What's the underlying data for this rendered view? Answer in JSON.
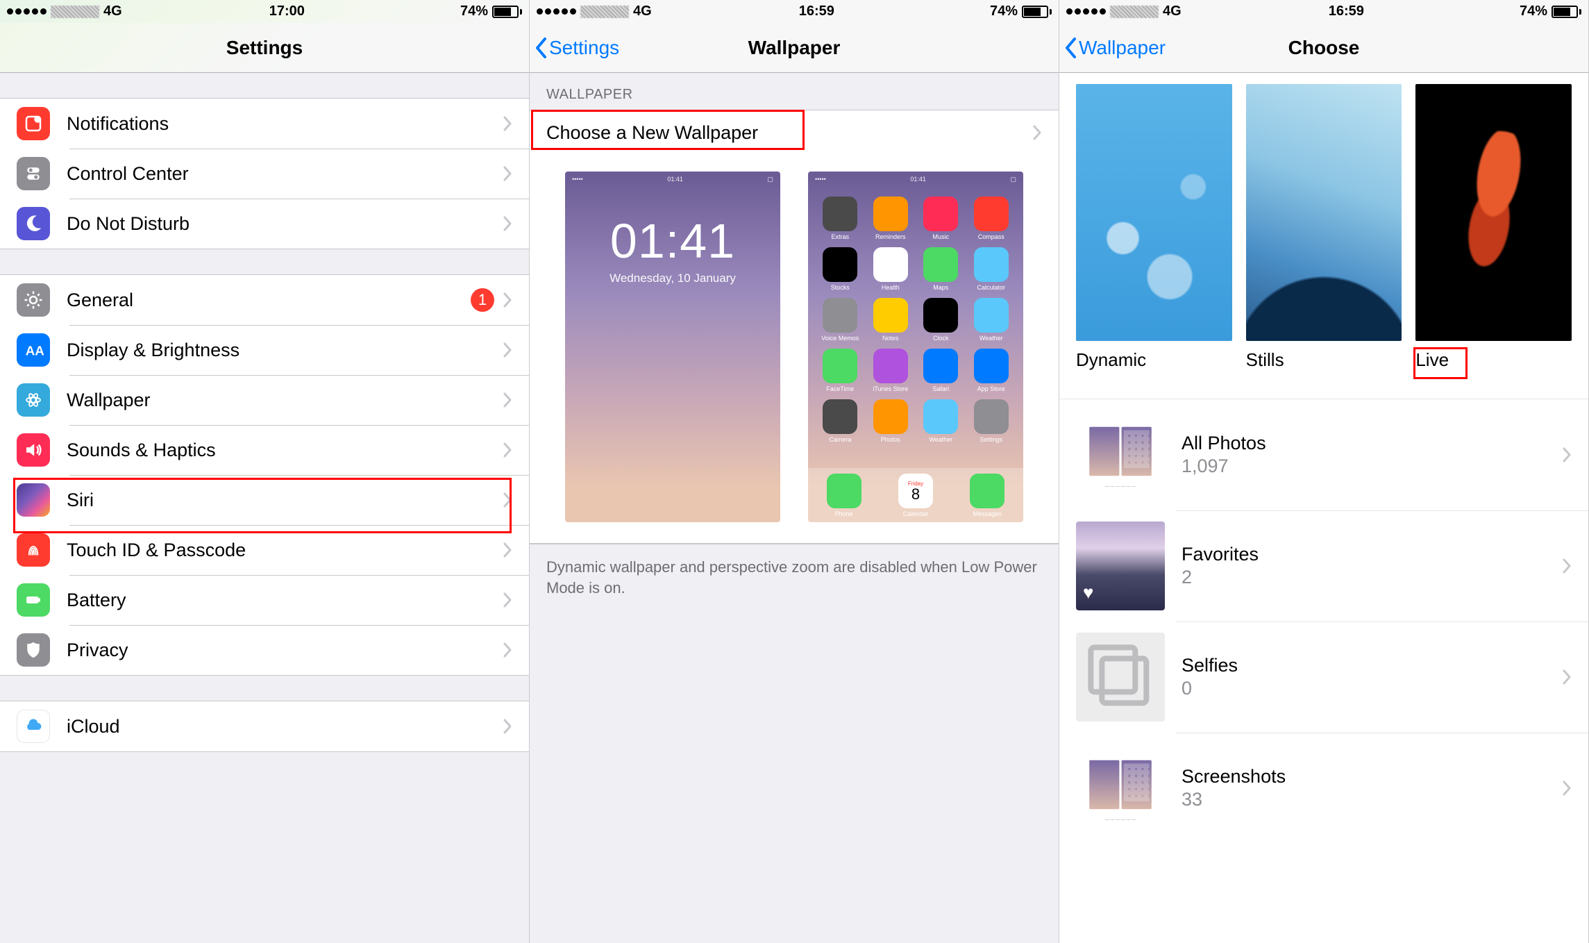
{
  "status": {
    "carrier_tech": "4G",
    "time_p1": "17:00",
    "time_p2": "16:59",
    "time_p3": "16:59",
    "battery_pct": "74%"
  },
  "panel1": {
    "title": "Settings",
    "group1": [
      {
        "label": "Notifications",
        "icon": "notifications-icon"
      },
      {
        "label": "Control Center",
        "icon": "control-center-icon"
      },
      {
        "label": "Do Not Disturb",
        "icon": "do-not-disturb-icon"
      }
    ],
    "group2": [
      {
        "label": "General",
        "icon": "general-icon",
        "badge": "1"
      },
      {
        "label": "Display & Brightness",
        "icon": "display-icon"
      },
      {
        "label": "Wallpaper",
        "icon": "wallpaper-icon"
      },
      {
        "label": "Sounds & Haptics",
        "icon": "sounds-icon"
      },
      {
        "label": "Siri",
        "icon": "siri-icon"
      },
      {
        "label": "Touch ID & Passcode",
        "icon": "touchid-icon"
      },
      {
        "label": "Battery",
        "icon": "battery-icon"
      },
      {
        "label": "Privacy",
        "icon": "privacy-icon"
      }
    ],
    "group3": [
      {
        "label": "iCloud",
        "icon": "icloud-icon"
      }
    ]
  },
  "panel2": {
    "back": "Settings",
    "title": "Wallpaper",
    "section_header": "WALLPAPER",
    "choose_row": "Choose a New Wallpaper",
    "preview_time": "01:41",
    "preview_date": "Wednesday, 10 January",
    "home_apps": [
      "Extras",
      "Reminders",
      "Music",
      "Compass",
      "Stocks",
      "Health",
      "Maps",
      "Calculator",
      "Voice Memos",
      "Notes",
      "Clock",
      "Weather",
      "FaceTime",
      "iTunes Store",
      "Safari",
      "App Store",
      "Camera",
      "Photos",
      "Weather",
      "Settings"
    ],
    "dock_apps": [
      "Phone",
      "Calendar",
      "Messages"
    ],
    "dock_date": "8",
    "dock_day": "Friday",
    "footer": "Dynamic wallpaper and perspective zoom are disabled when Low Power Mode is on."
  },
  "panel3": {
    "back": "Wallpaper",
    "title": "Choose",
    "cats": [
      "Dynamic",
      "Stills",
      "Live"
    ],
    "albums": [
      {
        "name": "All Photos",
        "count": "1,097"
      },
      {
        "name": "Favorites",
        "count": "2"
      },
      {
        "name": "Selfies",
        "count": "0"
      },
      {
        "name": "Screenshots",
        "count": "33"
      }
    ]
  }
}
